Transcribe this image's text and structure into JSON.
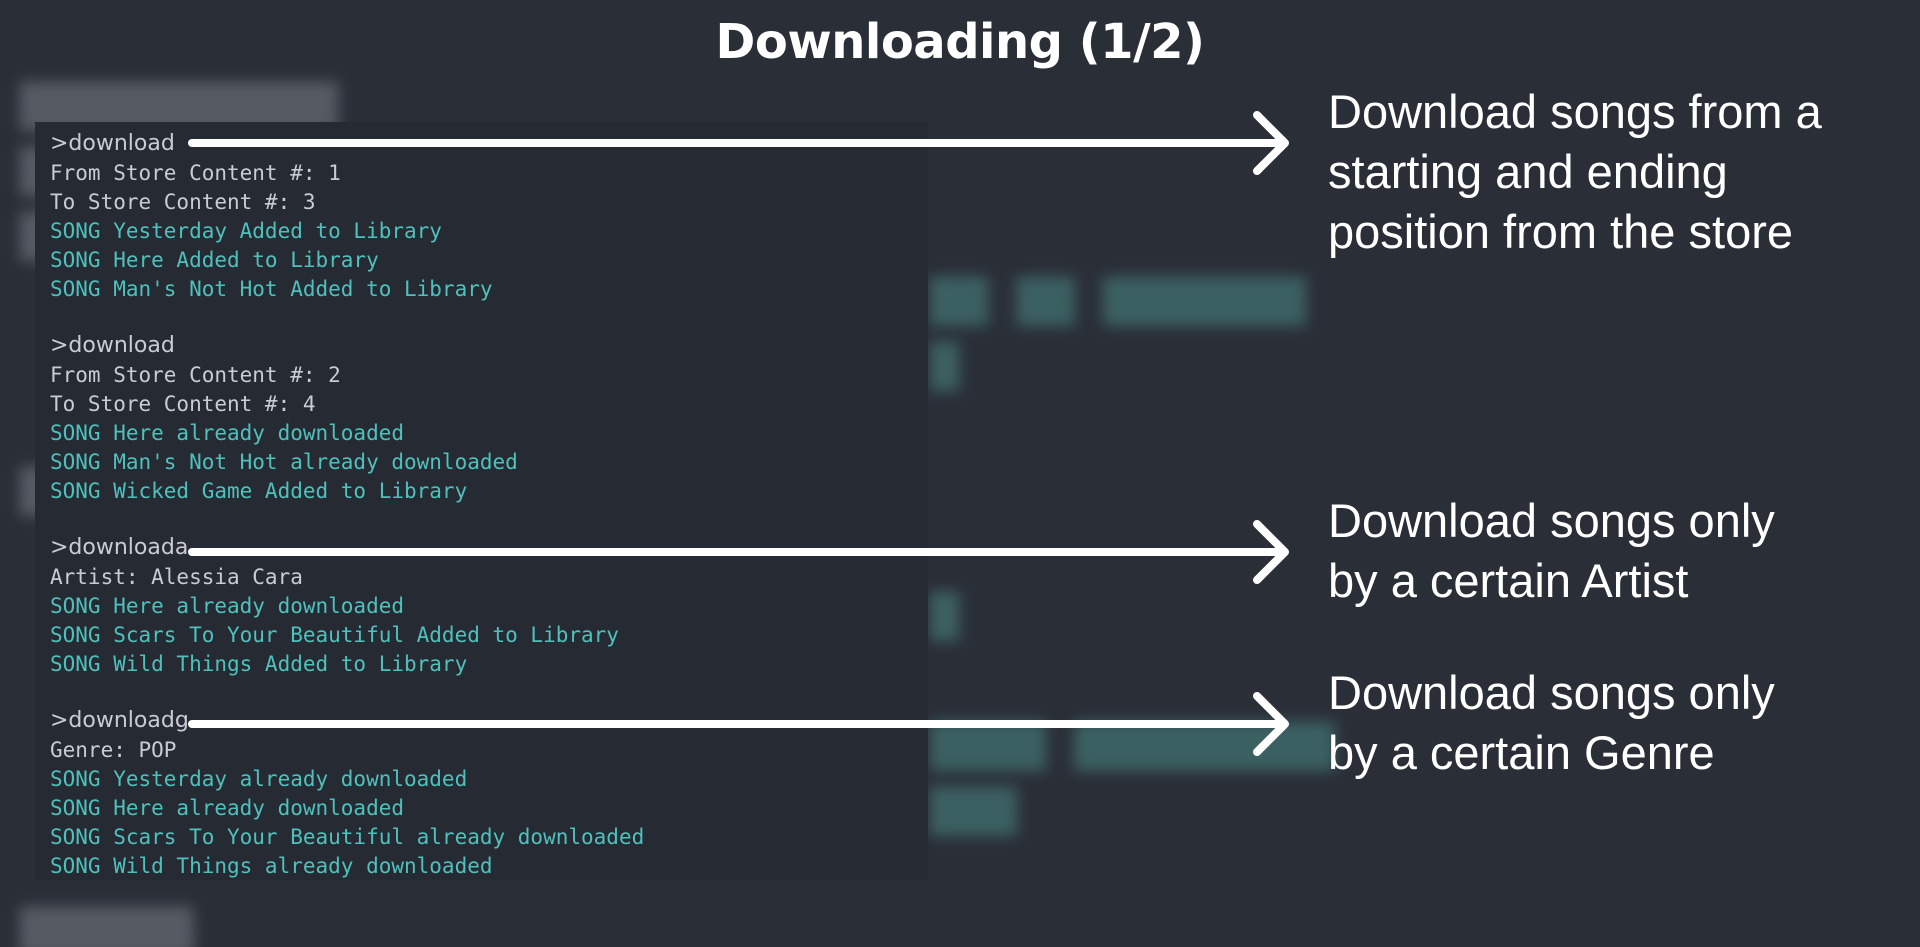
{
  "title": "Downloading (1/2)",
  "terminal": {
    "blocks": [
      {
        "command": ">download",
        "lines": [
          {
            "text": "From Store Content #: 1",
            "kind": "plain"
          },
          {
            "text": "To Store Content #: 3",
            "kind": "plain"
          },
          {
            "text": "SONG Yesterday Added to Library",
            "kind": "song"
          },
          {
            "text": "SONG Here Added to Library",
            "kind": "song"
          },
          {
            "text": "SONG Man's Not Hot Added to Library",
            "kind": "song"
          }
        ]
      },
      {
        "command": ">download",
        "lines": [
          {
            "text": "From Store Content #: 2",
            "kind": "plain"
          },
          {
            "text": "To Store Content #: 4",
            "kind": "plain"
          },
          {
            "text": "SONG Here already downloaded",
            "kind": "song"
          },
          {
            "text": "SONG Man's Not Hot already downloaded",
            "kind": "song"
          },
          {
            "text": "SONG Wicked Game Added to Library",
            "kind": "song"
          }
        ]
      },
      {
        "command": ">downloada",
        "lines": [
          {
            "text": "Artist: Alessia Cara",
            "kind": "plain"
          },
          {
            "text": "SONG Here already downloaded",
            "kind": "song"
          },
          {
            "text": "SONG Scars To Your Beautiful Added to Library",
            "kind": "song"
          },
          {
            "text": "SONG Wild Things Added to Library",
            "kind": "song"
          }
        ]
      },
      {
        "command": ">downloadg",
        "lines": [
          {
            "text": "Genre: POP",
            "kind": "plain"
          },
          {
            "text": "SONG Yesterday already downloaded",
            "kind": "song"
          },
          {
            "text": "SONG Here already downloaded",
            "kind": "song"
          },
          {
            "text": "SONG Scars To Your Beautiful already downloaded",
            "kind": "song"
          },
          {
            "text": "SONG Wild Things already downloaded",
            "kind": "song"
          }
        ]
      }
    ]
  },
  "annotations": [
    {
      "lines": [
        "Download songs from a",
        "starting and ending",
        "position from the store"
      ]
    },
    {
      "lines": [
        "Download songs only",
        "by a certain Artist"
      ]
    },
    {
      "lines": [
        "Download songs only",
        "by a certain Genre"
      ]
    }
  ],
  "colors": {
    "background": "#2a2e37",
    "terminal_background": "#262a33",
    "command_text": "#c9ccd1",
    "song_text": "#4fc1bd",
    "arrow": "#ffffff"
  }
}
